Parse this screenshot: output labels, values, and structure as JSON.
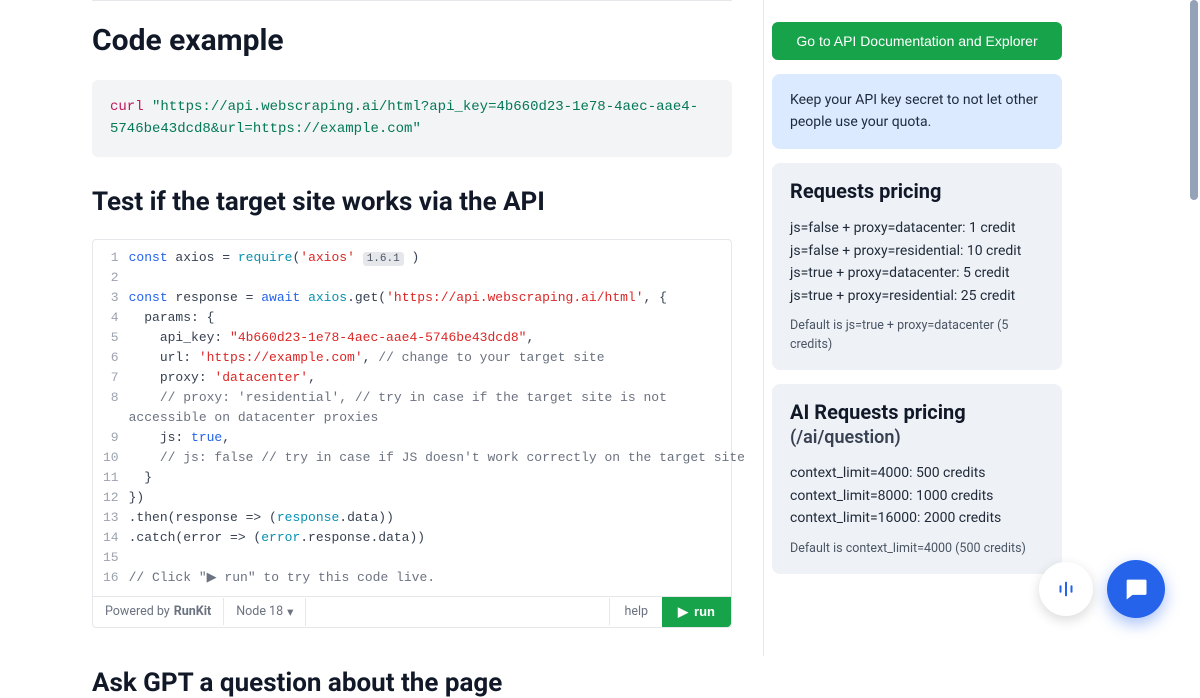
{
  "main": {
    "section1_title": "Code example",
    "curl_keyword": "curl ",
    "curl_url": "\"https://api.webscraping.ai/html?api_key=4b660d23-1e78-4aec-aae4-5746be43dcd8&url=https://example.com\"",
    "section2_title": "Test if the target site works via the API",
    "editor": {
      "line1_a": "const",
      "line1_b": " axios = ",
      "line1_c": "require",
      "line1_d": "(",
      "line1_e": "'axios'",
      "line1_ver": "1.6.1",
      "line1_f": ")",
      "line3_a": "const",
      "line3_b": " response = ",
      "line3_c": "await",
      "line3_d": " axios",
      "line3_e": ".get(",
      "line3_f": "'https://api.webscraping.ai/html'",
      "line3_g": ", {",
      "line4": "  params: {",
      "line5_a": "    api_key: ",
      "line5_b": "\"4b660d23-1e78-4aec-aae4-5746be43dcd8\"",
      "line5_c": ",",
      "line6_a": "    url: ",
      "line6_b": "'https://example.com'",
      "line6_c": ", ",
      "line6_d": "// change to your target site",
      "line7_a": "    proxy: ",
      "line7_b": "'datacenter'",
      "line7_c": ",",
      "line8_a": "    ",
      "line8_b": "// proxy: 'residential', // try in case if the target site is not accessible on datacenter proxies",
      "line9_a": "    js: ",
      "line9_b": "true",
      "line9_c": ",",
      "line10_a": "    ",
      "line10_b": "// js: false // try in case if JS doesn't work correctly on the target site",
      "line11": "  }",
      "line12": "})",
      "line13_a": ".then(response => (",
      "line13_b": "response",
      "line13_c": ".data))",
      "line14_a": ".catch(error => (",
      "line14_b": "error",
      "line14_c": ".response.data))",
      "line16": "// Click \"▶ run\" to try this code live.",
      "line_numbers": [
        "1",
        "2",
        "3",
        "4",
        "5",
        "6",
        "7",
        "8",
        "9",
        "10",
        "11",
        "12",
        "13",
        "14",
        "15",
        "16"
      ]
    },
    "footer": {
      "powered_pre": "Powered by ",
      "powered_brand": "RunKit",
      "node": "Node 18",
      "help": "help",
      "run": "run"
    },
    "bottom_heading": "Ask GPT a question about the page"
  },
  "sidebar": {
    "cta": "Go to API Documentation and Explorer",
    "secret_note": "Keep your API key secret to not let other people use your quota.",
    "pricing": {
      "title": "Requests pricing",
      "body": "js=false + proxy=datacenter: 1 credit\njs=false + proxy=residential: 10 credit\njs=true + proxy=datacenter: 5 credit\njs=true + proxy=residential: 25 credit",
      "footnote": "Default is js=true + proxy=datacenter (5 credits)"
    },
    "ai_pricing": {
      "title": "AI Requests pricing",
      "subtitle": "(/ai/question)",
      "body": "context_limit=4000: 500 credits\ncontext_limit=8000: 1000 credits\ncontext_limit=16000: 2000 credits",
      "footnote": "Default is context_limit=4000 (500 credits)"
    }
  },
  "icons": {
    "chevron": "▾",
    "play": "▶"
  }
}
